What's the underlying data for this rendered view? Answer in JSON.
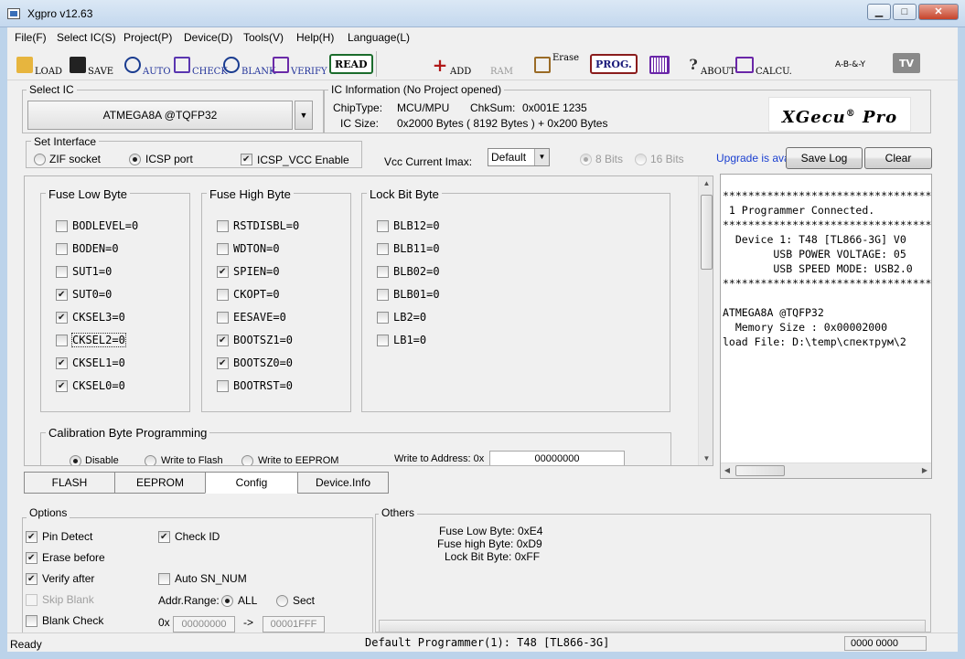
{
  "window": {
    "title": "Xgpro v12.63",
    "minimize": "▁",
    "maximize": "□",
    "close": "✕"
  },
  "menu": [
    "File(F)",
    "Select IC(S)",
    "Project(P)",
    "Device(D)",
    "Tools(V)",
    "Help(H)",
    "Language(L)"
  ],
  "toolbar": {
    "load": "LOAD",
    "save": "SAVE",
    "auto": "AUTO",
    "check": "CHECK",
    "blank": "BLANK",
    "verify": "VERIFY",
    "read": "READ",
    "add": "ADD",
    "ram": "RAM",
    "erase": "Erase",
    "prog": "PROG.",
    "about": "ABOUT",
    "calcu": "CALCU.",
    "tv": "TV",
    "logic": "A-B-&-Y"
  },
  "select_ic": {
    "title": "Select IC",
    "value": "ATMEGA8A @TQFP32"
  },
  "ic_info": {
    "title": "IC Information (No Project opened)",
    "chip_type_label": "ChipType:",
    "chip_type": "MCU/MPU",
    "chksum_label": "ChkSum:",
    "chksum": "0x001E 1235",
    "ic_size_label": "IC Size:",
    "ic_size": "0x2000 Bytes ( 8192 Bytes ) + 0x200 Bytes",
    "logo_main": "XGecu",
    "logo_reg": "®",
    "logo_pro": "Pro"
  },
  "interface": {
    "title": "Set Interface",
    "zif": "ZIF socket",
    "icsp": "ICSP port",
    "icsp_vcc": "ICSP_VCC Enable",
    "vcc_label": "Vcc Current Imax:",
    "vcc_value": "Default",
    "bits8": "8 Bits",
    "bits16": "16 Bits",
    "upgrade": "Upgrade is ava",
    "save_log": "Save Log",
    "clear": "Clear"
  },
  "fuse_low": {
    "title": "Fuse Low Byte",
    "items": [
      {
        "label": "BODLEVEL=0",
        "checked": false
      },
      {
        "label": "BODEN=0",
        "checked": false
      },
      {
        "label": "SUT1=0",
        "checked": false
      },
      {
        "label": "SUT0=0",
        "checked": true
      },
      {
        "label": "CKSEL3=0",
        "checked": true
      },
      {
        "label": "CKSEL2=0",
        "checked": false
      },
      {
        "label": "CKSEL1=0",
        "checked": true
      },
      {
        "label": "CKSEL0=0",
        "checked": true
      }
    ]
  },
  "fuse_high": {
    "title": "Fuse High Byte",
    "items": [
      {
        "label": "RSTDISBL=0",
        "checked": false
      },
      {
        "label": "WDTON=0",
        "checked": false
      },
      {
        "label": "SPIEN=0",
        "checked": true
      },
      {
        "label": "CKOPT=0",
        "checked": false
      },
      {
        "label": "EESAVE=0",
        "checked": false
      },
      {
        "label": "BOOTSZ1=0",
        "checked": true
      },
      {
        "label": "BOOTSZ0=0",
        "checked": true
      },
      {
        "label": "BOOTRST=0",
        "checked": false
      }
    ]
  },
  "lock_bits": {
    "title": "Lock Bit Byte",
    "items": [
      {
        "label": "BLB12=0",
        "checked": false
      },
      {
        "label": "BLB11=0",
        "checked": false
      },
      {
        "label": "BLB02=0",
        "checked": false
      },
      {
        "label": "BLB01=0",
        "checked": false
      },
      {
        "label": "LB2=0",
        "checked": false
      },
      {
        "label": "LB1=0",
        "checked": false
      }
    ]
  },
  "calibration": {
    "title": "Calibration Byte Programming",
    "disable": "Disable",
    "write_flash": "Write to Flash",
    "write_eeprom": "Write to EEPROM",
    "address_label": "Write to Address: 0x",
    "address": "00000000"
  },
  "log": [
    "**********************************",
    " 1 Programmer Connected.",
    "**********************************",
    "  Device 1: T48 [TL866-3G] V0",
    "        USB POWER VOLTAGE: 05",
    "        USB SPEED MODE: USB2.0",
    "**********************************",
    "",
    "ATMEGA8A @TQFP32",
    "  Memory Size : 0x00002000",
    "load File: D:\\temp\\спектрум\\2"
  ],
  "tabs": [
    "FLASH",
    "EEPROM",
    "Config",
    "Device.Info"
  ],
  "options": {
    "title": "Options",
    "pin_detect": "Pin Detect",
    "check_id": "Check ID",
    "erase_before": "Erase before",
    "verify_after": "Verify after",
    "auto_sn": "Auto SN_NUM",
    "skip_blank": "Skip Blank",
    "addr_range": "Addr.Range:",
    "all": "ALL",
    "sect": "Sect",
    "blank_check": "Blank Check",
    "hex_prefix": "0x",
    "addr_start": "00000000",
    "arrow": "->",
    "addr_end": "00001FFF"
  },
  "others": {
    "title": "Others",
    "fuse_low": "Fuse Low Byte: 0xE4",
    "fuse_high": "Fuse high Byte: 0xD9",
    "lock": "Lock Bit Byte: 0xFF"
  },
  "status": {
    "ready": "Ready",
    "programmer": "Default  Programmer(1): T48 [TL866-3G]",
    "counter": "0000 0000"
  }
}
